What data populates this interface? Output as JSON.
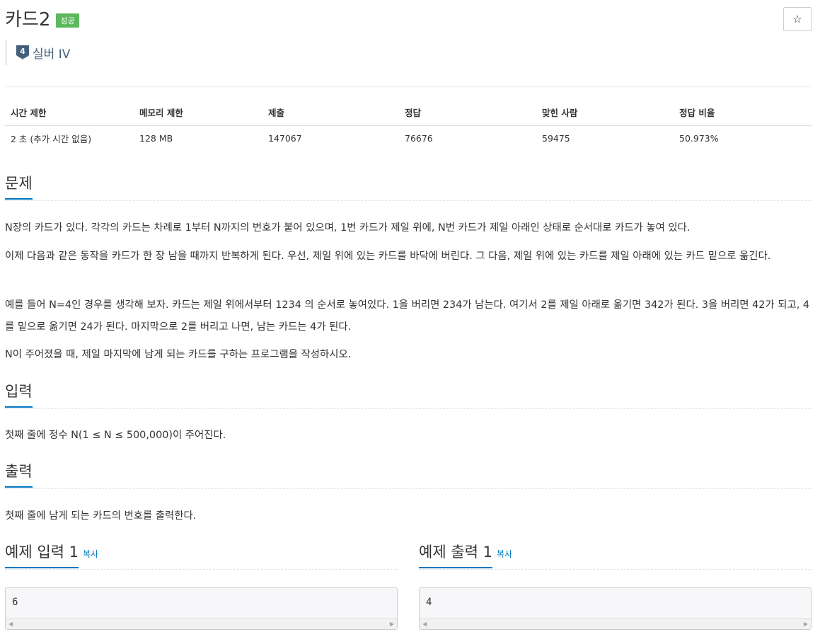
{
  "problem": {
    "title": "카드2",
    "status_badge": "성공",
    "star_icon": "☆",
    "tier": {
      "number": "4",
      "label": "실버 IV",
      "color": "#435f7a"
    }
  },
  "info_table": {
    "headers": [
      "시간 제한",
      "메모리 제한",
      "제출",
      "정답",
      "맞힌 사람",
      "정답 비율"
    ],
    "values": [
      "2 초 (추가 시간 없음)",
      "128 MB",
      "147067",
      "76676",
      "59475",
      "50.973%"
    ]
  },
  "sections": {
    "problem": {
      "heading": "문제",
      "paragraphs": [
        "N장의 카드가 있다. 각각의 카드는 차례로 1부터 N까지의 번호가 붙어 있으며, 1번 카드가 제일 위에, N번 카드가 제일 아래인 상태로 순서대로 카드가 놓여 있다.",
        "이제 다음과 같은 동작을 카드가 한 장 남을 때까지 반복하게 된다. 우선, 제일 위에 있는 카드를 바닥에 버린다. 그 다음, 제일 위에 있는 카드를 제일 아래에 있는 카드 밑으로 옮긴다.",
        "예를 들어 N=4인 경우를 생각해 보자. 카드는 제일 위에서부터 1234 의 순서로 놓여있다. 1을 버리면 234가 남는다. 여기서 2를 제일 아래로 옮기면 342가 된다. 3을 버리면 42가 되고, 4를 밑으로 옮기면 24가 된다. 마지막으로 2를 버리고 나면, 남는 카드는 4가 된다.",
        "N이 주어졌을 때, 제일 마지막에 남게 되는 카드를 구하는 프로그램을 작성하시오."
      ]
    },
    "input": {
      "heading": "입력",
      "text": "첫째 줄에 정수 N(1 ≤ N ≤ 500,000)이 주어진다."
    },
    "output": {
      "heading": "출력",
      "text": "첫째 줄에 남게 되는 카드의 번호를 출력한다."
    }
  },
  "samples": {
    "input": {
      "heading": "예제 입력 1",
      "copy_label": "복사",
      "value": "6"
    },
    "output": {
      "heading": "예제 출력 1",
      "copy_label": "복사",
      "value": "4"
    }
  },
  "colors": {
    "accent": "#0076c0",
    "success_badge": "#5cb85c"
  }
}
